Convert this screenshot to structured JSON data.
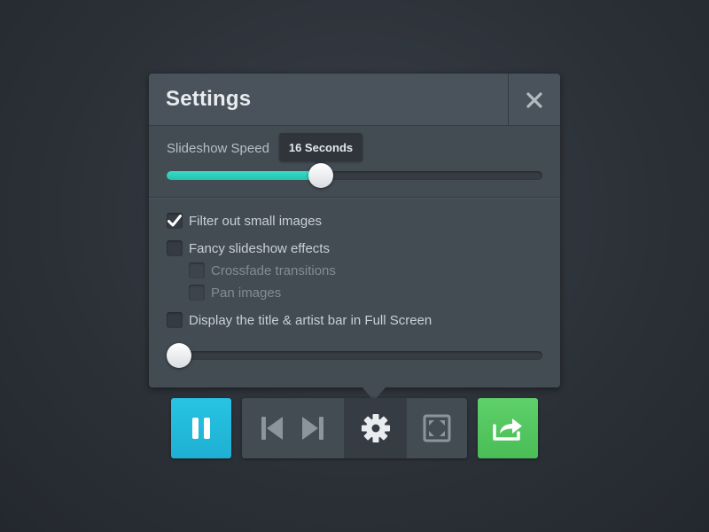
{
  "settings": {
    "title": "Settings",
    "close_icon": "close-icon",
    "slideshow_speed": {
      "label": "Slideshow Speed",
      "tooltip": "16 Seconds",
      "fraction": 0.41
    },
    "options": [
      {
        "label": "Filter out small images",
        "checked": true
      },
      {
        "label": "Fancy slideshow effects",
        "checked": false
      },
      {
        "label": "Crossfade transitions",
        "checked": false,
        "sub": true
      },
      {
        "label": "Pan images",
        "checked": false,
        "sub": true
      },
      {
        "label": "Display the title & artist bar in Full Screen",
        "checked": false
      }
    ],
    "second_slider": {
      "fraction": 0.0
    }
  },
  "controls": {
    "pause_icon": "pause-icon",
    "previous_icon": "skip-previous-icon",
    "next_icon": "skip-next-icon",
    "settings_icon": "gear-icon",
    "fullscreen_icon": "fullscreen-icon",
    "share_icon": "share-icon"
  },
  "colors": {
    "accent_teal": "#2fd3bf",
    "pause_blue": "#22b9dc",
    "share_green": "#53c75f",
    "panel": "#434b53"
  }
}
